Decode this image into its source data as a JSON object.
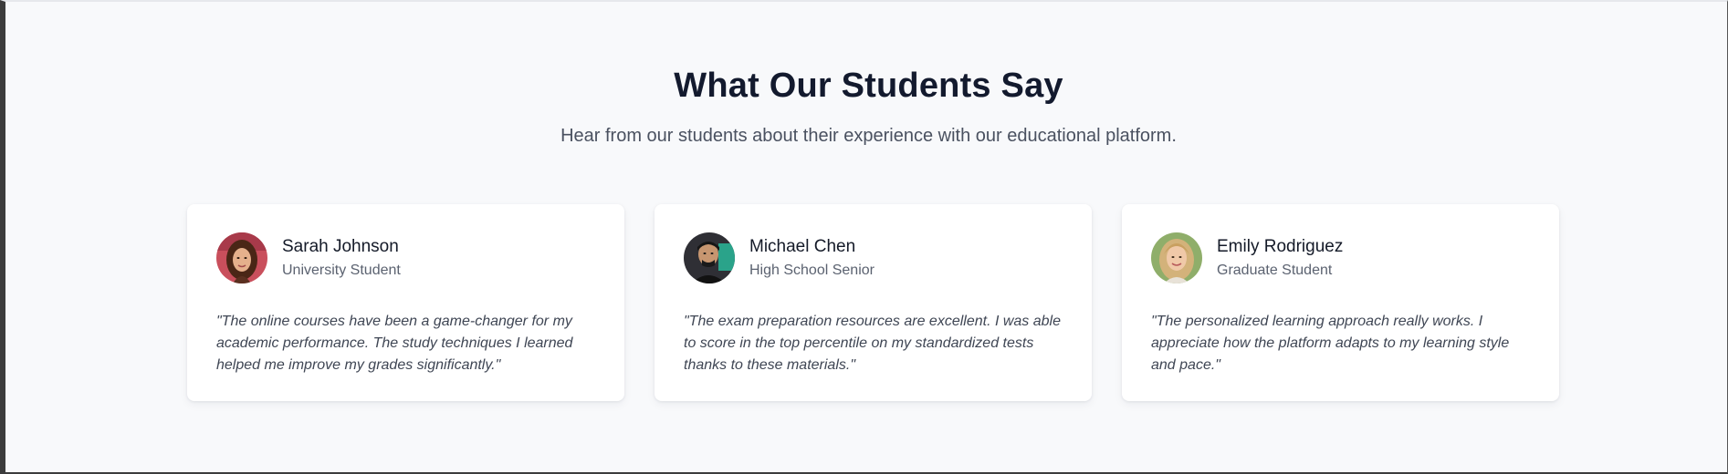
{
  "section": {
    "title": "What Our Students Say",
    "subtitle": "Hear from our students about their experience with our educational platform."
  },
  "testimonials": [
    {
      "name": "Sarah Johnson",
      "role": "University Student",
      "quote": "\"The online courses have been a game-changer for my academic performance. The study techniques I learned helped me improve my grades significantly.\"",
      "avatar": "avatar-sarah"
    },
    {
      "name": "Michael Chen",
      "role": "High School Senior",
      "quote": "\"The exam preparation resources are excellent. I was able to score in the top percentile on my standardized tests thanks to these materials.\"",
      "avatar": "avatar-michael"
    },
    {
      "name": "Emily Rodriguez",
      "role": "Graduate Student",
      "quote": "\"The personalized learning approach really works. I appreciate how the platform adapts to my learning style and pace.\"",
      "avatar": "avatar-emily"
    }
  ],
  "colors": {
    "background": "#f8f9fb",
    "heading": "#131a2e",
    "card": "#ffffff"
  }
}
